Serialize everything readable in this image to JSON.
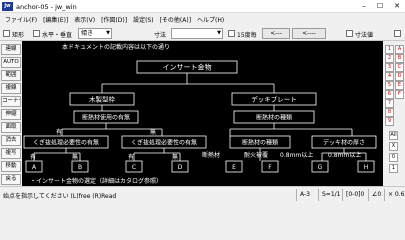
{
  "window": {
    "app_icon": "jw",
    "title": "anchor-05 - jw_win",
    "minimize": "–",
    "maximize": "☐",
    "close": "✕"
  },
  "menu": [
    "ファイル(F)",
    "[編集(E)]",
    "表示(V)",
    "[作図(D)]",
    "設定(S)",
    "[その他(A)]",
    "ヘルプ(H)"
  ],
  "options": {
    "rect_label": "矩形",
    "hv_label": "水平・垂直",
    "angle_value": "傾き",
    "dim_label": "寸法",
    "deg_label": "15度毎",
    "btn1": "<---",
    "btn2": "<----",
    "dimval_label": "寸法値"
  },
  "left_toolbar": [
    "範囲",
    "線",
    "矩形",
    "円",
    "文字",
    "寸法",
    "2線",
    "中心線",
    "連線",
    "AUTO",
    "範囲",
    "複線",
    "コーナー",
    "伸縮",
    "面取",
    "消去",
    "複写",
    "移動",
    "戻る",
    "新規",
    "開く",
    "上書"
  ],
  "right_toolbar": {
    "numbers": [
      "1",
      "2",
      "3",
      "4",
      "5",
      "6",
      "7",
      "8",
      "9"
    ],
    "letters": [
      "A",
      "B",
      "C",
      "D",
      "E",
      "F"
    ],
    "labels": [
      "All",
      "X",
      "0",
      "1"
    ]
  },
  "drawing": {
    "top_text": "本ドキュメントの記載内容は以下の通り",
    "root": "インサート金物",
    "branch_left": "木製型枠",
    "branch_right": "デッキプレート",
    "q_insulation_left": "断熱材使用の有無",
    "q_insulation_right": "断熱材の種類",
    "yes": "有",
    "no": "無",
    "q_nail_left": "くぎ抜処理必要性の有無",
    "q_nail_right": "くぎ抜処理必要性の有無",
    "q_thickness": "デッキ材の厚さ",
    "insulation_label": "断熱材",
    "type_fire": "耐火被覆",
    "thick_1": "0.8mm以上",
    "thick_2": "0.8mm以下",
    "thick_3": "0.8mm以上",
    "leaves": [
      "A",
      "B",
      "C",
      "D",
      "E",
      "F",
      "G",
      "H"
    ],
    "bottom_text": "・インサート金物の選定（詳細はカタログ参照）"
  },
  "status": {
    "message": "始点を指示してください (L)free (R)Read",
    "paper": "A-3",
    "scale": "S=1/1",
    "layer": "[0-0]0",
    "angle": "∠0",
    "zoom": "× 0.6"
  },
  "colors": {
    "canvas_bg": "#000000",
    "canvas_line": "#ffffff",
    "titlebar_icon": "#1f3a93",
    "accent_red": "#c00000"
  }
}
